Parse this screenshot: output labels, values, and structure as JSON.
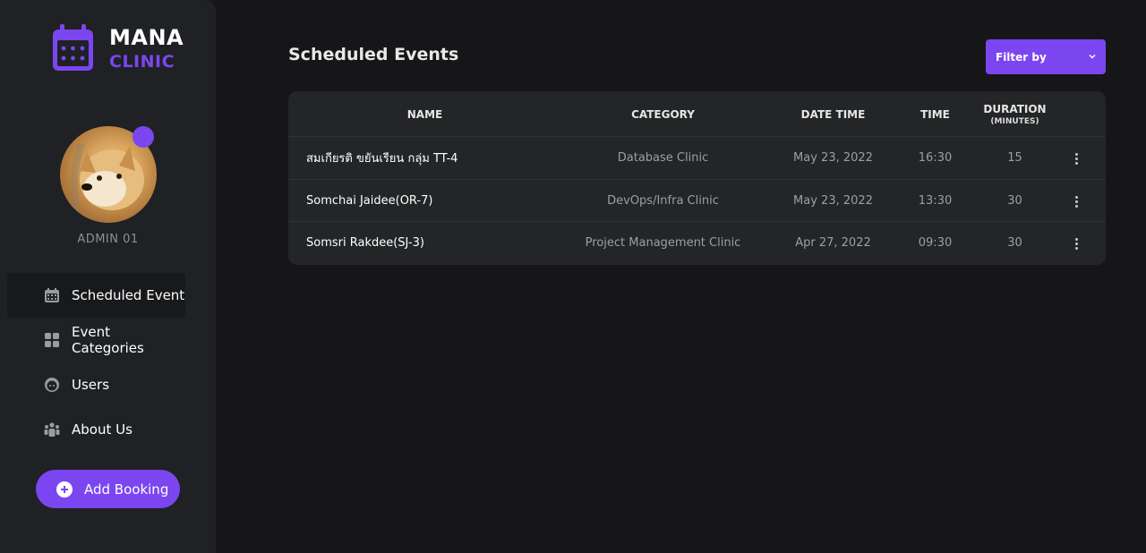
{
  "brand": {
    "line1": "MANA",
    "line2": "CLINIC"
  },
  "user": {
    "name": "ADMIN 01"
  },
  "nav": {
    "items": [
      {
        "label": "Scheduled Event",
        "icon": "calendar-icon",
        "active": true
      },
      {
        "label": "Event Categories",
        "icon": "grid-icon",
        "active": false
      },
      {
        "label": "Users",
        "icon": "user-face-icon",
        "active": false
      },
      {
        "label": "About Us",
        "icon": "group-icon",
        "active": false
      }
    ]
  },
  "add_booking": {
    "label": "Add Booking",
    "icon": "plus-circle-icon"
  },
  "page": {
    "title": "Scheduled Events"
  },
  "filter": {
    "label": "Filter by",
    "icon": "chevron-down-icon"
  },
  "table": {
    "headers": {
      "name": "NAME",
      "category": "CATEGORY",
      "datetime": "DATE TIME",
      "time": "TIME",
      "duration": "DURATION",
      "duration_sub": "(MINUTES)"
    },
    "rows": [
      {
        "name": "สมเกียรติ ขยันเรียน กลุ่ม TT-4",
        "category": "Database Clinic",
        "date": "May 23, 2022",
        "time": "16:30",
        "duration": "15"
      },
      {
        "name": "Somchai Jaidee(OR-7)",
        "category": "DevOps/Infra Clinic",
        "date": "May 23, 2022",
        "time": "13:30",
        "duration": "30"
      },
      {
        "name": "Somsri Rakdee(SJ-3)",
        "category": "Project Management Clinic",
        "date": "Apr 27, 2022",
        "time": "09:30",
        "duration": "30"
      }
    ]
  },
  "colors": {
    "accent": "#7b46ef",
    "sidebar": "#1f2124",
    "background": "#161618",
    "card": "#232527"
  }
}
